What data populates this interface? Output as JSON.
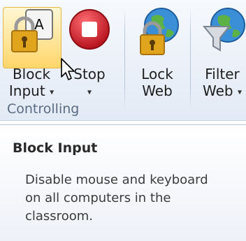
{
  "ribbon": {
    "buttons": [
      {
        "label_line1": "Block",
        "label_line2": "Input",
        "icon": "block-input-icon",
        "has_dropdown": true
      },
      {
        "label_line1": "Stop",
        "icon": "stop-icon",
        "has_dropdown": true
      },
      {
        "label_line1": "Lock",
        "label_line2": "Web",
        "icon": "lock-web-icon",
        "has_dropdown": false
      },
      {
        "label_line1": "Filter",
        "label_line2": "Web",
        "icon": "filter-web-icon",
        "has_dropdown": true
      }
    ],
    "group_label": "Controlling"
  },
  "tooltip": {
    "title": "Block Input",
    "body": "Disable mouse and keyboard\non all computers in the\nclassroom."
  },
  "colors": {
    "highlight": "#ffe59a",
    "stop_red": "#d9232f",
    "lock_gold": "#e0a51c",
    "globe_blue": "#3a8fd6"
  }
}
